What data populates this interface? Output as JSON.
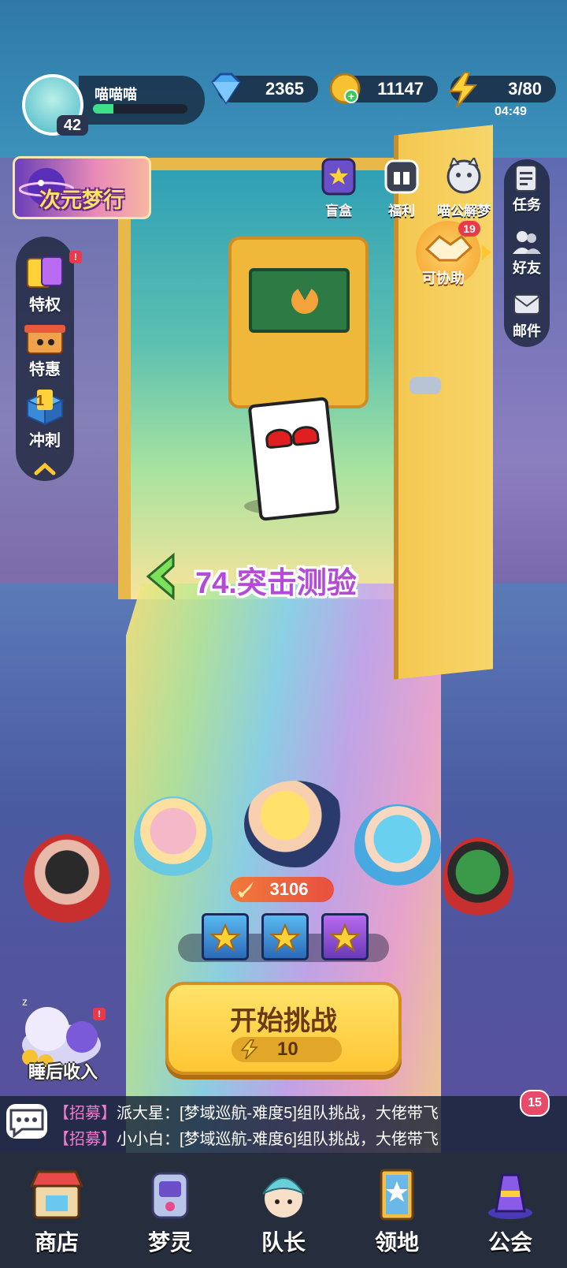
{
  "player": {
    "name": "喵喵喵",
    "level": "42",
    "exp_progress": 0.22
  },
  "resources": {
    "diamonds": "2365",
    "gold": "11147",
    "energy": "3/80",
    "energy_timer": "04:49"
  },
  "event_banner": "次元梦行",
  "top_buttons": {
    "blind_box": "盲盒",
    "welfare": "福利",
    "dream": "喵公解梦",
    "assist": "可协助",
    "assist_count": "19"
  },
  "right_buttons": {
    "tasks": "任务",
    "friends": "好友",
    "mail": "邮件"
  },
  "left_buttons": {
    "privilege": "特权",
    "sale": "特惠",
    "sprint": "冲刺",
    "sprint_badge": "1"
  },
  "stage": {
    "title": "74.突击测验"
  },
  "team": {
    "power": "3106"
  },
  "start": {
    "label": "开始挑战",
    "cost": "10"
  },
  "sleep_income": "睡后收入",
  "chat": {
    "unread": "15",
    "messages": [
      {
        "tag": "【招募】",
        "text": "派大星：[梦域巡航-难度5]组队挑战，大佬带飞"
      },
      {
        "tag": "【招募】",
        "text": "小小白：[梦域巡航-难度6]组队挑战，大佬带飞"
      }
    ]
  },
  "nav": [
    "商店",
    "梦灵",
    "队长",
    "领地",
    "公会"
  ],
  "colors": {
    "accent": "#ffc634",
    "stage_title": "#b34ad8",
    "exp": "#3ee08a",
    "badge": "#e83a4a"
  },
  "icons": [
    "diamond-icon",
    "gold-coin-icon",
    "lightning-icon",
    "back-arrow-icon",
    "chat-icon",
    "sword-icon",
    "star-chest-icon"
  ]
}
